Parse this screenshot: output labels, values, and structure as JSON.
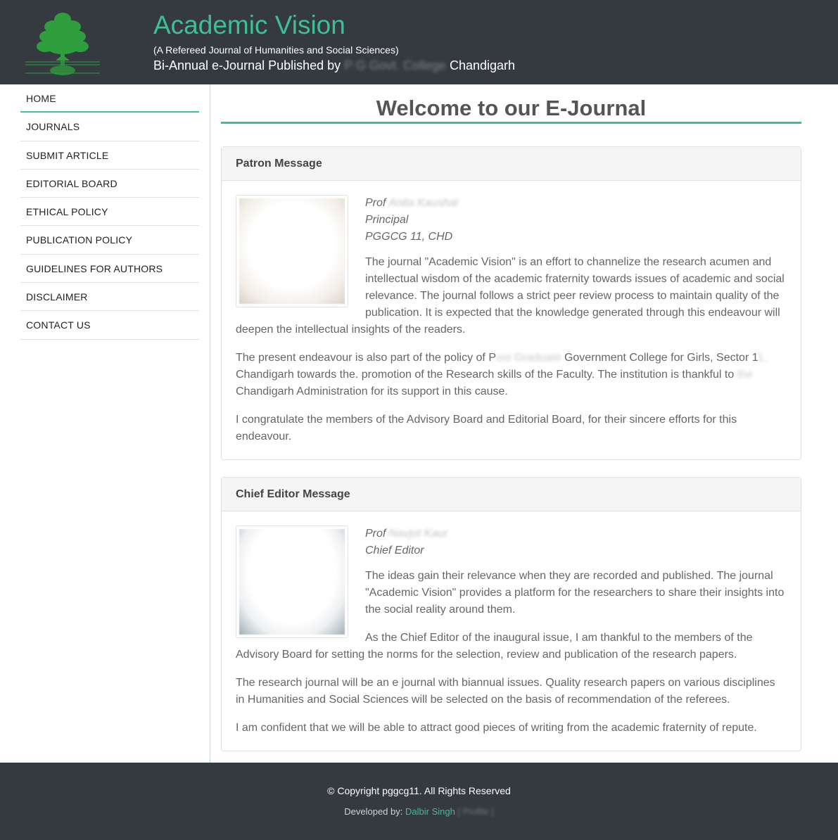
{
  "header": {
    "title": "Academic Vision",
    "subtitle": "(A Refereed Journal of Humanities and Social Sciences)",
    "published_prefix": "Bi-Annual e-Journal Published by",
    "published_blurred": "P G Govt. College",
    "published_suffix": "Chandigarh",
    "colors": {
      "bg": "#343a40",
      "accent": "#3fbf94"
    },
    "logo_icon": "tree-logo-icon"
  },
  "nav": {
    "items": [
      {
        "label": "HOME",
        "active": true
      },
      {
        "label": "JOURNALS"
      },
      {
        "label": "SUBMIT ARTICLE"
      },
      {
        "label": "EDITORIAL BOARD"
      },
      {
        "label": "ETHICAL POLICY"
      },
      {
        "label": "PUBLICATION POLICY"
      },
      {
        "label": "GUIDELINES FOR AUTHORS"
      },
      {
        "label": "DISCLAIMER"
      },
      {
        "label": "CONTACT US"
      }
    ]
  },
  "main": {
    "heading": "Welcome to our E-Journal",
    "patron": {
      "title": "Patron Message",
      "name_prefix": "Prof ",
      "name_blurred": "Anita Kaushal",
      "role": "Principal",
      "org": "PGGCG 11, CHD",
      "p1": "The journal \"Academic Vision\" is an effort to channelize the research acumen and intellectual wisdom of the academic fraternity towards issues of academic and social relevance. The journal follows a strict peer review process to maintain quality of the publication. It is expected that the knowledge generated through this endeavour will deepen the intellectual insights of the readers.",
      "p2_a": "The present endeavour is also part of the policy of P",
      "p2_blur1": "ost Graduate",
      "p2_b": " Government College for Girls, Sector 1",
      "p2_blur2": "1,",
      "p2_c": " Chandigarh towards the. promotion of the Research skills of the Faculty. The institution is thankful to",
      "p2_blur3": " the",
      "p2_d": " Chandigarh Administration for its support in this cause.",
      "p3": "I congratulate the members of the Advisory Board and Editorial Board, for their sincere efforts for this endeavour."
    },
    "editor": {
      "title": "Chief Editor Message",
      "name_prefix": "Prof ",
      "name_blurred": "Navjot Kaur",
      "role": "Chief Editor",
      "p1": "The ideas gain their relevance when they are recorded and published. The journal \"Academic Vision\" provides a platform for the researchers to share their insights into the social reality around them.",
      "p2": "As the Chief Editor of the inaugural issue, I am thankful to the members of the Advisory Board for setting the norms for the selection, review and publication of the research papers.",
      "p3": "The research journal will be an e journal with biannual issues. Quality research papers on various disciplines in Humanities and Social Sciences will be selected on the basis of recommendation of the referees.",
      "p4": "I am confident that we will be able to attract good pieces of writing from the academic fraternity of repute."
    }
  },
  "footer": {
    "copyright": "© Copyright pggcg11. All Rights Reserved",
    "dev_prefix": "Developed by:",
    "dev_name": "Dalbir Singh",
    "dev_blurred": "[ Profile ]"
  }
}
